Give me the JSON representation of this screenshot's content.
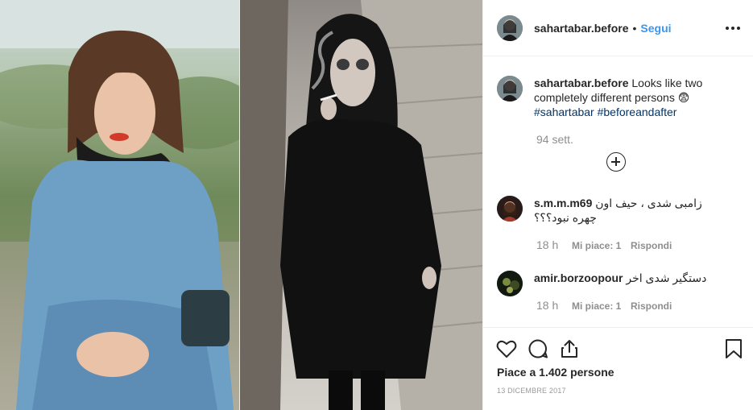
{
  "post": {
    "username": "sahartabar.before",
    "dot": "•",
    "follow_label": "Segui"
  },
  "caption": {
    "username": "sahartabar.before",
    "text": "Looks like two completely different persons 😨",
    "hashtag1": "#sahartabar",
    "hashtag2": "#beforeandafter",
    "ago": "94 sett."
  },
  "comments": [
    {
      "username": "s.m.m.m69",
      "text": "زامبی شدی ، حیف اون چهره نبود؟؟؟",
      "time": "18 h",
      "likes": "Mi piace: 1",
      "reply": "Rispondi"
    },
    {
      "username": "amir.borzoopour",
      "text": "دستگیر شدی اخر",
      "time": "18 h",
      "likes": "Mi piace: 1",
      "reply": "Rispondi"
    }
  ],
  "footer": {
    "likes_text": "Piace a 1.402 persone",
    "date": "13 DICEMBRE 2017"
  },
  "icons": {
    "like": "heart-icon",
    "comment": "comment-icon",
    "share": "share-icon",
    "save": "bookmark-icon",
    "more": "more-options-icon",
    "load_more": "plus-circle-icon"
  }
}
